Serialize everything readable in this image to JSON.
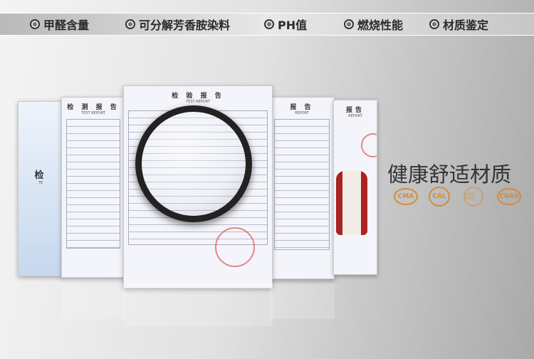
{
  "top_tags": [
    "甲醛含量",
    "可分解芳香胺染料",
    "PH值",
    "燃烧性能",
    "材质鉴定"
  ],
  "documents": [
    {
      "title": "检",
      "subtitle": "TE"
    },
    {
      "title": "检 测 报 告",
      "subtitle": "TEST REPORT"
    },
    {
      "title": "检 验 报 告",
      "subtitle": "TEST REPORT"
    },
    {
      "title": "报 告",
      "subtitle": "REPORT"
    },
    {
      "title": "报告",
      "subtitle": "REPORT"
    }
  ],
  "slogan": "健康舒适材质",
  "cert_logos": [
    "CMA",
    "CAL",
    "ILAC-MRA",
    "CNAS"
  ],
  "colors": {
    "logo": "#d48a3a",
    "seal": "#dc3c3c",
    "slogan": "#333333"
  }
}
